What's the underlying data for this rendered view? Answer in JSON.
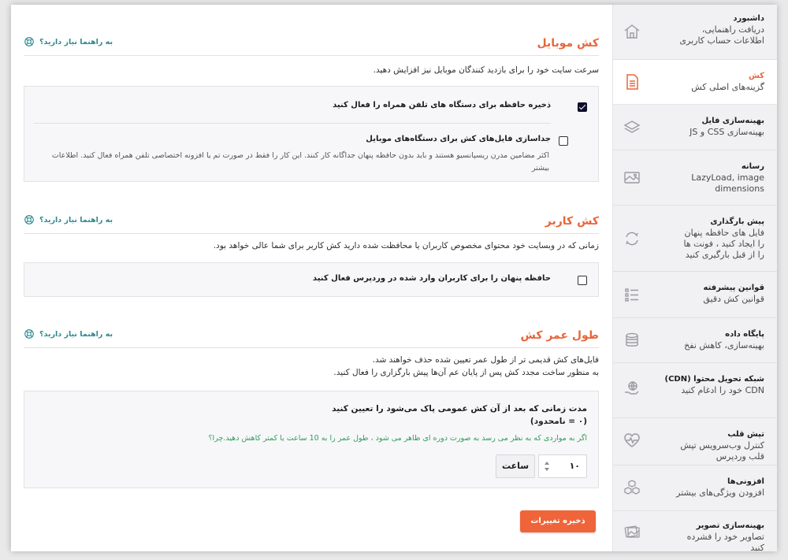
{
  "sidebar": {
    "items": [
      {
        "title": "داشبورد",
        "sub": "دریافت راهنمایی، اطلاعات حساب کاربری",
        "icon": "home-icon"
      },
      {
        "title": "کش",
        "sub": "گزینه‌های اصلی کش",
        "icon": "document-icon"
      },
      {
        "title": "بهینه‌سازی فایل",
        "sub": "بهینه‌سازی CSS و JS",
        "icon": "layers-icon"
      },
      {
        "title": "رسانه",
        "sub": "LazyLoad, image dimensions",
        "icon": "image-icon"
      },
      {
        "title": "پیش بارگذاری",
        "sub": "فایل های حافظه پنهان را ایجاد کنید ، فونت ها را از قبل بارگیری کنید",
        "icon": "refresh-icon"
      },
      {
        "title": "قوانین پیشرفته",
        "sub": "قوانین کش دقیق",
        "icon": "list-icon"
      },
      {
        "title": "پایگاه داده",
        "sub": "بهینه‌سازی، کاهش نفخ",
        "icon": "database-icon"
      },
      {
        "title": "شبکه تحویل محتوا (CDN)",
        "sub": "CDN خود را ادغام کنید",
        "icon": "cdn-icon"
      },
      {
        "title": "تپش قلب",
        "sub": "کنترل وب‌سرویس تپش قلب وردپرس",
        "icon": "heartbeat-icon"
      },
      {
        "title": "افزونی‌ها",
        "sub": "افزودن ویژگی‌های بیشتر",
        "icon": "addons-icon"
      },
      {
        "title": "بهینه‌سازی تصویر",
        "sub": "تصاویر خود را فشرده کنید",
        "icon": "photo-icon"
      }
    ]
  },
  "help_label": "به راهنما نیاز دارید؟",
  "mobile": {
    "title": "کش موبایل",
    "description": "سرعت سایت خود را برای بازدید کنندگان موبایل نیز افزایش دهید.",
    "opt1_label": "ذخیره حافظه برای دستگاه های تلفن همراه را فعال کنید",
    "opt2_label": "جداسازی فایل‌های کش برای دستگاه‌های موبایل",
    "opt2_desc": "اکثر مضامین مدرن ریسپانسیو هستند و باید بدون حافظه پنهان جداگانه کار کنند. این کار را فقط در صورت تم یا افزونه اختصاصی تلفن همراه فعال کنید. اطلاعات بیشتر"
  },
  "user": {
    "title": "کش کاربر",
    "description": "زمانی که در وبسایت خود محتوای مخصوص کاربران یا محافظت شده دارید کش کاربر برای شما عالی خواهد بود.",
    "opt_label": "حافظه پنهان را برای کاربران وارد شده در وردپرس فعال کنید"
  },
  "lifespan": {
    "title": "طول عمر کش",
    "desc_line1": "فایل‌های کش قدیمی تر از طول عمر تعیین شده حذف خواهند شد.",
    "desc_line2": "به منظور ساخت مجدد کش پس از پایان عم آن‌ها پیش بارگزاری را فعال کنید.",
    "field_label": "مدت زمانی که بعد از آن کش عمومی پاک می‌شود را تعیین کنید",
    "field_hint": "(۰ = نامحدود)",
    "advice": "اگر به مواردی که به نظر می رسد به صورت دوره ای ظاهر می شود ، طول عمر را به 10 ساعت یا کمتر کاهش دهید.چرا؟",
    "value": "۱۰",
    "unit": "ساعت"
  },
  "save_label": "ذخیره تغییرات",
  "colors": {
    "accent": "#e8663a",
    "help": "#2d8a8f",
    "advice": "#2e9e57",
    "save": "#f0643a"
  }
}
